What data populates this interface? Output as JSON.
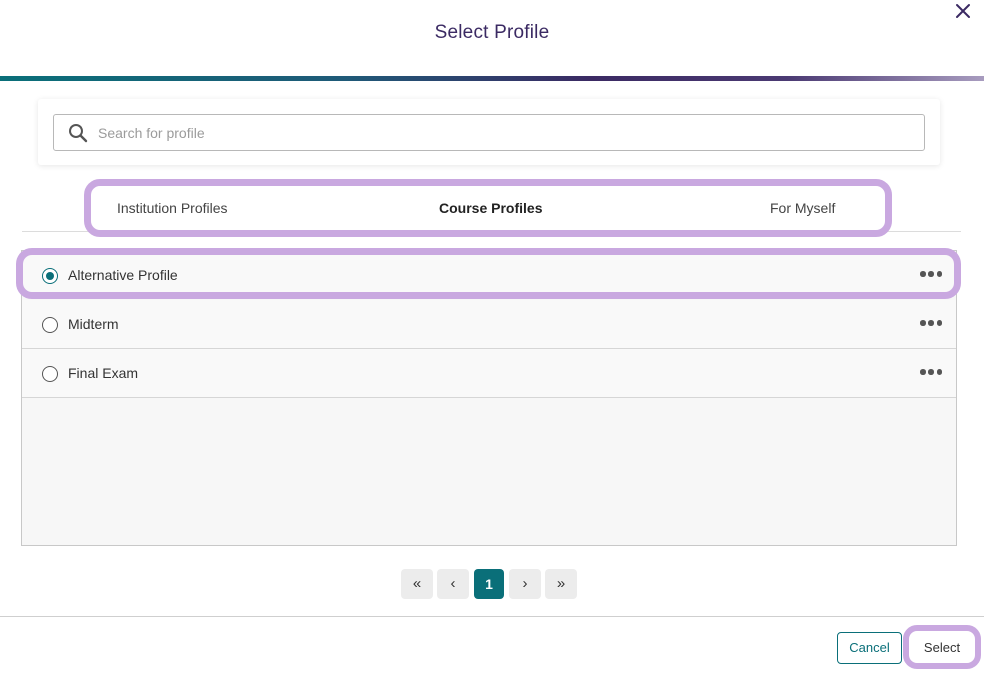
{
  "dialog": {
    "title": "Select Profile",
    "close_icon": "close-icon"
  },
  "search": {
    "placeholder": "Search for profile",
    "value": "",
    "icon": "search-icon"
  },
  "tabs": [
    {
      "label": "Institution Profiles",
      "active": false
    },
    {
      "label": "Course Profiles",
      "active": true
    },
    {
      "label": "For Myself",
      "active": false
    }
  ],
  "profiles": [
    {
      "label": "Alternative Profile",
      "selected": true
    },
    {
      "label": "Midterm",
      "selected": false
    },
    {
      "label": "Final Exam",
      "selected": false
    }
  ],
  "pagination": {
    "first": "«",
    "prev": "‹",
    "current": "1",
    "next": "›",
    "last": "»"
  },
  "footer": {
    "cancel_label": "Cancel",
    "select_label": "Select"
  },
  "colors": {
    "accent": "#0a6f79",
    "title": "#3b2a63",
    "highlight": "#c9a8e0"
  }
}
